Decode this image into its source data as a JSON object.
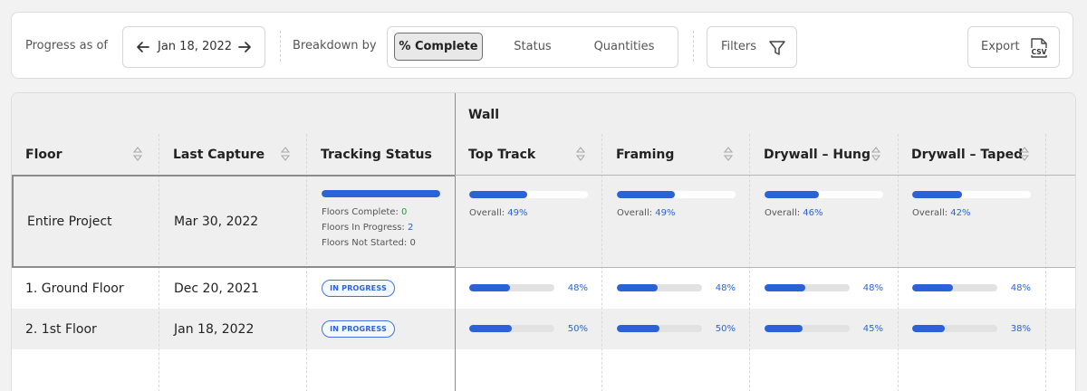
{
  "toolbar": {
    "progress_label": "Progress as of",
    "date": "Jan 18, 2022",
    "breakdown_label": "Breakdown by",
    "breakdown_options": [
      "% Complete",
      "Status",
      "Quantities"
    ],
    "breakdown_selected": "% Complete",
    "filters_label": "Filters",
    "export_label": "Export",
    "export_icon_text": "CSV"
  },
  "table": {
    "group_header": "Wall",
    "columns": [
      "Floor",
      "Last Capture",
      "Tracking Status",
      "Top Track",
      "Framing",
      "Drywall – Hung",
      "Drywall – Taped"
    ],
    "summary": {
      "floor": "Entire Project",
      "last_capture": "Mar 30, 2022",
      "tracking_progress": 1.0,
      "floors_complete_label": "Floors Complete:",
      "floors_complete": "0",
      "floors_in_progress_label": "Floors In Progress:",
      "floors_in_progress": "2",
      "floors_not_started_label": "Floors Not Started:",
      "floors_not_started": "0",
      "overall_label": "Overall:",
      "overall": [
        "49%",
        "49%",
        "46%",
        "42%"
      ],
      "overall_values": [
        49,
        49,
        46,
        42
      ]
    },
    "rows": [
      {
        "floor": "1. Ground Floor",
        "last_capture": "Dec 20, 2021",
        "status": "IN PROGRESS",
        "percents": [
          "48%",
          "48%",
          "48%",
          "48%"
        ],
        "values": [
          48,
          48,
          48,
          48
        ]
      },
      {
        "floor": "2. 1st Floor",
        "last_capture": "Jan 18, 2022",
        "status": "IN PROGRESS",
        "percents": [
          "50%",
          "50%",
          "45%",
          "38%"
        ],
        "values": [
          50,
          50,
          45,
          38
        ]
      }
    ]
  },
  "colors": {
    "accent": "#2b62d8",
    "success": "#2a9a3c",
    "track": "#e2e2e2"
  }
}
